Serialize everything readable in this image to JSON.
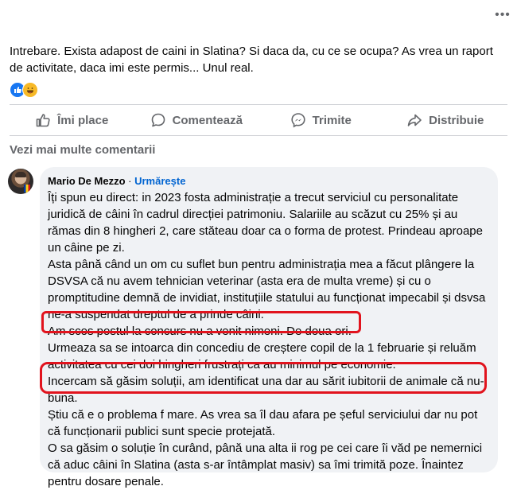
{
  "post": {
    "more_label": "•••",
    "text": "Intrebare. Exista adapost de caini in Slatina? Si daca da, cu ce se ocupa? As vrea un raport de activitate, daca imi este permis... Unul real."
  },
  "reactions": [
    {
      "icon": "like-reaction-icon",
      "color": "#1877f2"
    },
    {
      "icon": "haha-reaction-icon",
      "color": "#f7b928"
    }
  ],
  "actions": {
    "like_label": "Îmi place",
    "comment_label": "Comentează",
    "send_label": "Trimite",
    "share_label": "Distribuie"
  },
  "comments_section": {
    "view_more_label": "Vezi mai multe comentarii"
  },
  "comment": {
    "author": "Mario De Mezzo",
    "separator": "·",
    "follow_label": "Urmărește",
    "paragraphs": [
      "Îți spun eu direct: in 2023 fosta administrație a trecut serviciul cu personalitate juridică de câini în cadrul direcției patrimoniu. Salariile au scăzut cu 25% și au rămas din 8 hingheri 2, care stăteau doar ca o forma de protest. Prindeau aproape un câine pe zi.",
      "Asta până când un om cu suflet bun pentru administrația mea a făcut plângere la DSVSA că nu avem tehnician veterinar (asta era de multa vreme) și cu o promptitudine demnă de invidiat, instituțiile statului au funcționat impecabil și dsvsa ne-a suspendat dreptul de a prinde câini.",
      "Am scos postul la concurs nu a venit nimeni. De doua ori.",
      "Urmeaza sa se intoarca din concediu de creștere copil de la 1 februarie și reluăm activitatea cu cei doi hingheri frustrați ca au minimul pe economie.",
      "Incercam să găsim soluții, am identificat una dar au sărit iubitorii de animale că nu-i buna.",
      "Știu că e o problema f mare. As vrea sa îl dau afara pe șeful serviciului dar nu pot că funcționarii publici sunt specie protejată.",
      "O sa găsim o soluție în curând, până una alta ii rog pe cei care îi văd pe nemernici că aduc câini în Slatina (asta s-ar întâmplat masiv) sa îmi trimită poze. Înaintez pentru dosare penale."
    ]
  },
  "colors": {
    "accent": "#0064d1",
    "highlight_marker": "#e1131d",
    "bubble_bg": "#f0f2f5",
    "muted_text": "#65676b"
  }
}
